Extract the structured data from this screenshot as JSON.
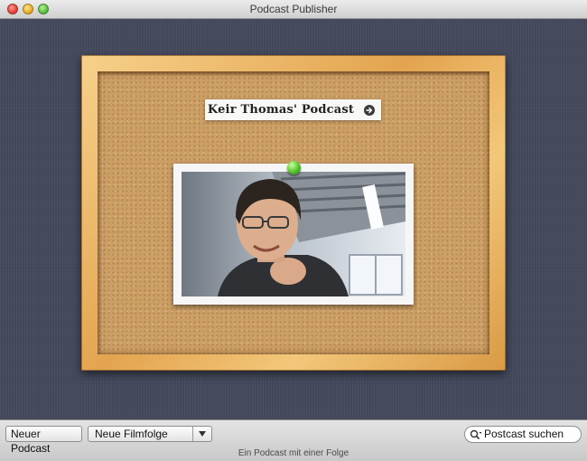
{
  "window": {
    "title": "Podcast Publisher"
  },
  "board": {
    "podcast_title": "Keir Thomas' Podcast",
    "arrow_icon": "arrow-right-circle-icon",
    "pin_icon": "green-pushpin-icon"
  },
  "toolbar": {
    "new_podcast_label": "Neuer Podcast",
    "new_episode_popup": {
      "selected": "Neue Filmfolge"
    }
  },
  "search": {
    "placeholder": "Postcast suchen"
  },
  "status": {
    "text": "Ein Podcast mit einer Folge"
  },
  "colors": {
    "linen": "#444a5d",
    "cork": "#cc9f65",
    "frame": "#e3a44f",
    "pin": "#53c22b"
  }
}
